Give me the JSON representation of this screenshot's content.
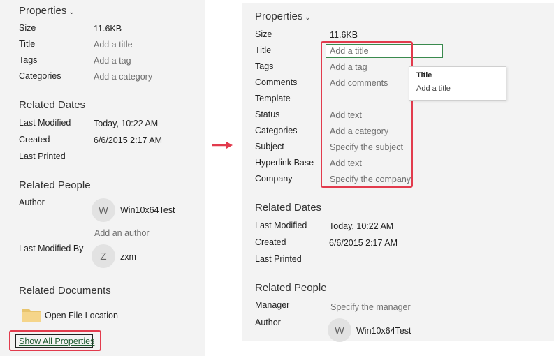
{
  "left": {
    "properties": {
      "heading": "Properties",
      "rows": [
        {
          "label": "Size",
          "value": "11.6KB"
        },
        {
          "label": "Title",
          "value": "Add a title"
        },
        {
          "label": "Tags",
          "value": "Add a tag"
        },
        {
          "label": "Categories",
          "value": "Add a category"
        }
      ]
    },
    "related_dates": {
      "heading": "Related Dates",
      "rows": [
        {
          "label": "Last Modified",
          "value": "Today, 10:22 AM"
        },
        {
          "label": "Created",
          "value": "6/6/2015 2:17 AM"
        },
        {
          "label": "Last Printed",
          "value": ""
        }
      ]
    },
    "related_people": {
      "heading": "Related People",
      "author_label": "Author",
      "author_initial": "W",
      "author_name": "Win10x64Test",
      "add_author": "Add an author",
      "last_modified_by_label": "Last Modified By",
      "modifier_initial": "Z",
      "modifier_name": "zxm"
    },
    "related_documents": {
      "heading": "Related Documents",
      "open_location": "Open File Location",
      "show_all": "Show All Properties"
    }
  },
  "right": {
    "properties": {
      "heading": "Properties",
      "rows": [
        {
          "label": "Size",
          "value": "11.6KB"
        },
        {
          "label": "Title",
          "value": "Add a title"
        },
        {
          "label": "Tags",
          "value": "Add a tag"
        },
        {
          "label": "Comments",
          "value": "Add comments"
        },
        {
          "label": "Template",
          "value": ""
        },
        {
          "label": "Status",
          "value": "Add text"
        },
        {
          "label": "Categories",
          "value": "Add a category"
        },
        {
          "label": "Subject",
          "value": "Specify the subject"
        },
        {
          "label": "Hyperlink Base",
          "value": "Add text"
        },
        {
          "label": "Company",
          "value": "Specify the company"
        }
      ]
    },
    "tooltip": {
      "title": "Title",
      "text": "Add a title"
    },
    "related_dates": {
      "heading": "Related Dates",
      "rows": [
        {
          "label": "Last Modified",
          "value": "Today, 10:22 AM"
        },
        {
          "label": "Created",
          "value": "6/6/2015 2:17 AM"
        },
        {
          "label": "Last Printed",
          "value": ""
        }
      ]
    },
    "related_people": {
      "heading": "Related People",
      "manager_label": "Manager",
      "manager_value": "Specify the manager",
      "author_label": "Author",
      "author_initial": "W",
      "author_name": "Win10x64Test"
    }
  },
  "colors": {
    "highlight": "#e23b4d",
    "input_border": "#3a8a4e",
    "link": "#1d5a2f",
    "panel_bg": "#f3f3f3"
  },
  "icons": {
    "chevron": "chevron-down-icon",
    "folder": "folder-icon",
    "arrow": "arrow-right-icon"
  }
}
